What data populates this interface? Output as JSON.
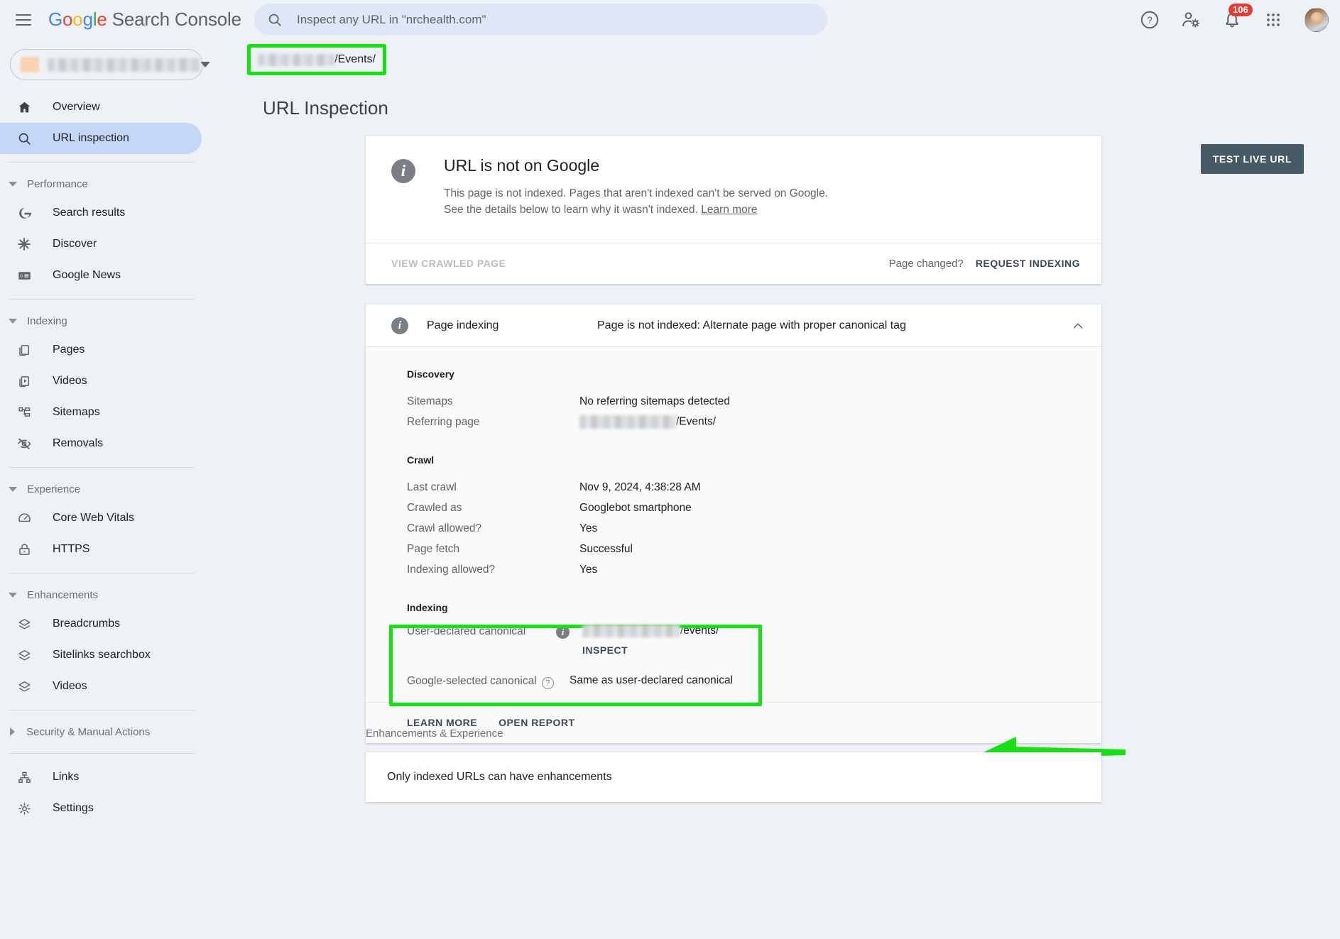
{
  "header": {
    "menu_label": "Main menu",
    "brand": {
      "g": "G",
      "o1": "o",
      "o2": "o",
      "gg": "g",
      "l": "l",
      "e": "e",
      "suffix": " Search Console"
    },
    "search": {
      "placeholder": "Inspect any URL in \"nrchealth.com\"",
      "value": ""
    },
    "icons": {
      "help": "help-icon",
      "settings_user": "account-settings-icon",
      "notifications": "notifications-icon",
      "apps": "google-apps-icon",
      "avatar": "user-avatar"
    },
    "notification_count": "106"
  },
  "url_chip": {
    "redacted": "",
    "visible_suffix": "/Events/"
  },
  "sidebar": {
    "property_selector": {
      "name_redacted": "",
      "caret": "chevron-down-icon"
    },
    "items": [
      {
        "label": "Overview",
        "icon": "home-icon",
        "type": "item",
        "active": false
      },
      {
        "label": "URL inspection",
        "icon": "search-icon",
        "type": "item",
        "active": true
      },
      {
        "type": "divider"
      },
      {
        "label": "Performance",
        "type": "group",
        "expanded": true
      },
      {
        "label": "Search results",
        "icon": "google-g-icon",
        "type": "item",
        "active": false
      },
      {
        "label": "Discover",
        "icon": "discover-asterisk-icon",
        "type": "item",
        "active": false
      },
      {
        "label": "Google News",
        "icon": "google-news-icon",
        "type": "item",
        "active": false
      },
      {
        "type": "divider"
      },
      {
        "label": "Indexing",
        "type": "group",
        "expanded": true
      },
      {
        "label": "Pages",
        "icon": "pages-icon",
        "type": "item",
        "active": false
      },
      {
        "label": "Videos",
        "icon": "video-indexing-icon",
        "type": "item",
        "active": false
      },
      {
        "label": "Sitemaps",
        "icon": "sitemaps-icon",
        "type": "item",
        "active": false
      },
      {
        "label": "Removals",
        "icon": "eye-off-icon",
        "type": "item",
        "active": false
      },
      {
        "type": "divider"
      },
      {
        "label": "Experience",
        "type": "group",
        "expanded": true
      },
      {
        "label": "Core Web Vitals",
        "icon": "speedometer-icon",
        "type": "item",
        "active": false
      },
      {
        "label": "HTTPS",
        "icon": "lock-icon",
        "type": "item",
        "active": false
      },
      {
        "type": "divider"
      },
      {
        "label": "Enhancements",
        "type": "group",
        "expanded": true
      },
      {
        "label": "Breadcrumbs",
        "icon": "layers-icon",
        "type": "item",
        "active": false
      },
      {
        "label": "Sitelinks searchbox",
        "icon": "layers-icon",
        "type": "item",
        "active": false
      },
      {
        "label": "Videos",
        "icon": "layers-icon",
        "type": "item",
        "active": false
      },
      {
        "type": "divider"
      },
      {
        "label": "Security & Manual Actions",
        "type": "group",
        "expanded": false
      },
      {
        "type": "divider"
      },
      {
        "label": "Links",
        "icon": "links-icon",
        "type": "item",
        "active": false
      },
      {
        "label": "Settings",
        "icon": "gear-icon",
        "type": "item",
        "active": false
      }
    ]
  },
  "main": {
    "page_title": "URL Inspection",
    "test_live_url_button": "TEST LIVE URL",
    "status_card": {
      "icon": "info-icon",
      "title": "URL is not on Google",
      "description_part1": "This page is not indexed. Pages that aren't indexed can't be served on Google. See the details below to learn why it wasn't indexed. ",
      "learn_more": "Learn more",
      "view_crawled_page": "VIEW CRAWLED PAGE",
      "page_changed_label": "Page changed?",
      "request_indexing": "REQUEST INDEXING"
    },
    "page_indexing": {
      "icon": "info-icon",
      "label": "Page indexing",
      "value": "Page is not indexed: Alternate page with proper canonical tag",
      "collapse_icon": "chevron-up-icon",
      "sections": [
        {
          "heading": "Discovery",
          "rows": [
            {
              "key": "Sitemaps",
              "value": "No referring sitemaps detected",
              "redacted": false
            },
            {
              "key": "Referring page",
              "value": "/Events/",
              "redacted": true
            }
          ]
        },
        {
          "heading": "Crawl",
          "rows": [
            {
              "key": "Last crawl",
              "value": "Nov 9, 2024, 4:38:28 AM",
              "redacted": false
            },
            {
              "key": "Crawled as",
              "value": "Googlebot smartphone",
              "redacted": false
            },
            {
              "key": "Crawl allowed?",
              "value": "Yes",
              "redacted": false
            },
            {
              "key": "Page fetch",
              "value": "Successful",
              "redacted": false
            },
            {
              "key": "Indexing allowed?",
              "value": "Yes",
              "redacted": false
            }
          ]
        }
      ],
      "indexing_section": {
        "heading": "Indexing",
        "user_declared_canonical": {
          "key": "User-declared canonical",
          "info_icon": "info-icon",
          "value_suffix": "/events/",
          "inspect_button": "INSPECT"
        },
        "google_selected_canonical": {
          "key": "Google-selected canonical",
          "help_icon": "help-circle-icon",
          "value": "Same as user-declared canonical"
        }
      },
      "footer": {
        "learn_more": "LEARN MORE",
        "open_report": "OPEN REPORT"
      }
    },
    "enhancements": {
      "section_label": "Enhancements & Experience",
      "message": "Only indexed URLs can have enhancements"
    }
  },
  "annotations": {
    "highlight_color": "#15e115",
    "arrow": "green-left-arrow",
    "boxes": [
      "url-chip-highlight",
      "canonical-highlight"
    ]
  }
}
